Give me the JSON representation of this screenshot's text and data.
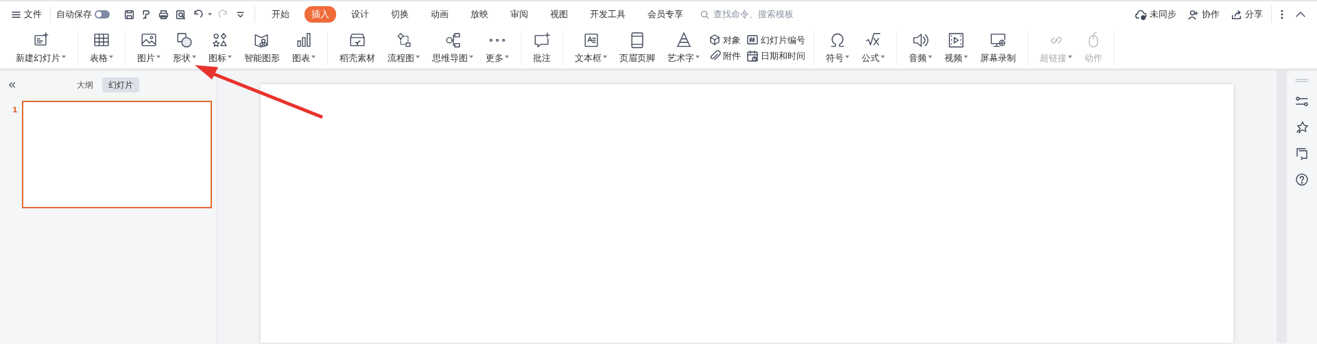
{
  "topbar": {
    "file_menu": "文件",
    "autosave": {
      "label": "自动保存",
      "on": false
    },
    "quick_tools": [
      {
        "kind": "save",
        "disabled": false
      },
      {
        "kind": "format",
        "disabled": false
      },
      {
        "kind": "print",
        "disabled": false
      },
      {
        "kind": "preview",
        "disabled": false
      },
      {
        "kind": "undo",
        "disabled": false
      },
      {
        "kind": "redo",
        "disabled": true
      },
      {
        "kind": "customize",
        "disabled": false
      }
    ],
    "tabs": [
      {
        "label": "开始",
        "selected": false
      },
      {
        "label": "插入",
        "selected": true
      },
      {
        "label": "设计",
        "selected": false
      },
      {
        "label": "切换",
        "selected": false
      },
      {
        "label": "动画",
        "selected": false
      },
      {
        "label": "放映",
        "selected": false
      },
      {
        "label": "审阅",
        "selected": false
      },
      {
        "label": "视图",
        "selected": false
      },
      {
        "label": "开发工具",
        "selected": false
      },
      {
        "label": "会员专享",
        "selected": false
      }
    ],
    "search": {
      "placeholder": "查找命令、搜索模板"
    },
    "actions": [
      {
        "kind": "sync",
        "label": "未同步"
      },
      {
        "kind": "collab",
        "label": "协作"
      },
      {
        "kind": "share",
        "label": "分享"
      }
    ]
  },
  "ribbon": [
    [
      {
        "kind": "large",
        "label": "新建幻灯片",
        "dropdown": true,
        "disabled": false
      }
    ],
    [
      {
        "kind": "large",
        "label": "表格",
        "dropdown": true,
        "disabled": false
      }
    ],
    [
      {
        "kind": "large",
        "label": "图片",
        "dropdown": true,
        "disabled": false
      },
      {
        "kind": "large",
        "label": "形状",
        "dropdown": true,
        "disabled": false
      },
      {
        "kind": "large",
        "label": "图标",
        "dropdown": true,
        "disabled": false
      },
      {
        "kind": "large",
        "label": "智能图形",
        "dropdown": false,
        "disabled": false
      },
      {
        "kind": "large",
        "label": "图表",
        "dropdown": true,
        "disabled": false
      }
    ],
    [
      {
        "kind": "large",
        "label": "稻壳素材",
        "dropdown": false,
        "disabled": false
      },
      {
        "kind": "large",
        "label": "流程图",
        "dropdown": true,
        "disabled": false
      },
      {
        "kind": "large",
        "label": "思维导图",
        "dropdown": true,
        "disabled": false
      },
      {
        "kind": "large",
        "label": "更多",
        "dropdown": true,
        "disabled": false
      }
    ],
    [
      {
        "kind": "large",
        "label": "批注",
        "dropdown": false,
        "disabled": false
      }
    ],
    [
      {
        "kind": "large",
        "label": "文本框",
        "dropdown": true,
        "disabled": false
      },
      {
        "kind": "large",
        "label": "页眉页脚",
        "dropdown": false,
        "disabled": false
      },
      {
        "kind": "large",
        "label": "艺术字",
        "dropdown": true,
        "disabled": false
      },
      {
        "kind": "pair",
        "items": [
          {
            "label": "对象"
          },
          {
            "label": "附件"
          }
        ]
      },
      {
        "kind": "pair",
        "items": [
          {
            "label": "幻灯片编号"
          },
          {
            "label": "日期和时间"
          }
        ]
      }
    ],
    [
      {
        "kind": "large",
        "label": "符号",
        "dropdown": true,
        "disabled": false
      },
      {
        "kind": "large",
        "label": "公式",
        "dropdown": true,
        "disabled": false
      }
    ],
    [
      {
        "kind": "large",
        "label": "音频",
        "dropdown": true,
        "disabled": false
      },
      {
        "kind": "large",
        "label": "视频",
        "dropdown": true,
        "disabled": false
      },
      {
        "kind": "large",
        "label": "屏幕录制",
        "dropdown": false,
        "disabled": false
      }
    ],
    [
      {
        "kind": "large",
        "label": "超链接",
        "dropdown": true,
        "disabled": true
      },
      {
        "kind": "large",
        "label": "动作",
        "dropdown": false,
        "disabled": true
      }
    ]
  ],
  "sidebar": {
    "tabs": [
      {
        "label": "大纲",
        "selected": false
      },
      {
        "label": "幻灯片",
        "selected": true
      }
    ],
    "slides": [
      {
        "number": "1",
        "selected": true
      }
    ]
  }
}
